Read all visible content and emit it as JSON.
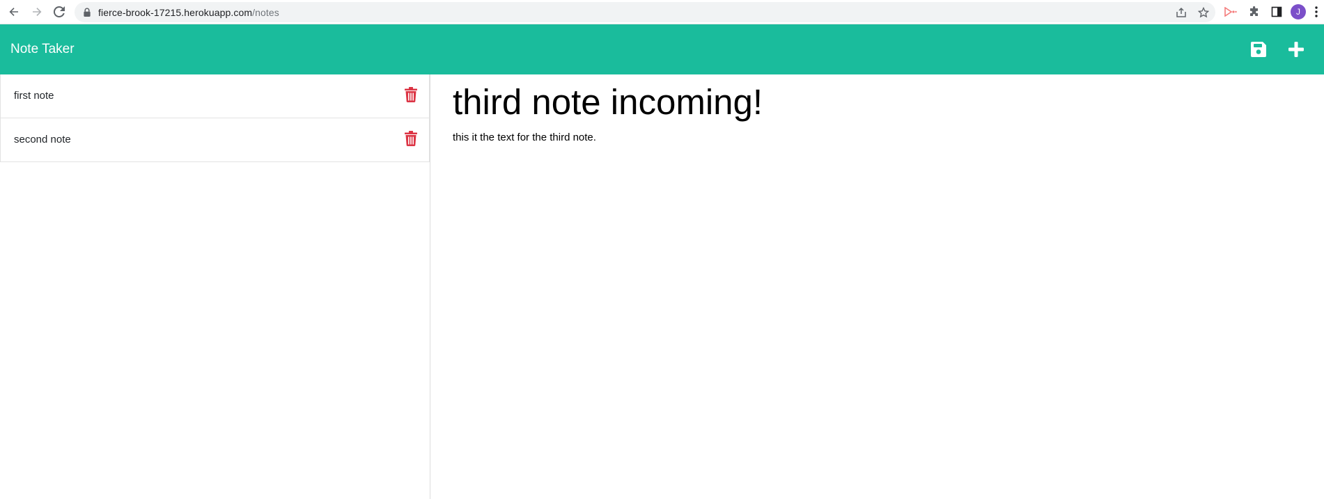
{
  "browser": {
    "url_host": "fierce-brook-17215.herokuapp.com",
    "url_path": "/notes",
    "profile_initial": "J"
  },
  "icons": {
    "back": "arrow-left-icon",
    "forward": "arrow-right-icon",
    "reload": "reload-icon",
    "lock": "lock-icon",
    "share": "share-icon",
    "bookmark": "star-icon",
    "extension_red": "extension-icon",
    "extensions": "puzzle-icon",
    "side_panel": "side-panel-icon",
    "menu": "kebab-menu-icon",
    "save": "floppy-disk-icon",
    "new_note": "plus-icon",
    "delete": "trash-icon"
  },
  "colors": {
    "navbar": "#1abc9c",
    "delete_icon": "#dc3545",
    "avatar": "#7b4fc9"
  },
  "app": {
    "brand": "Note Taker"
  },
  "notes": [
    {
      "title": "first note"
    },
    {
      "title": "second note"
    }
  ],
  "active_note": {
    "title": "third note incoming!",
    "text": "this it the text for the third note."
  }
}
